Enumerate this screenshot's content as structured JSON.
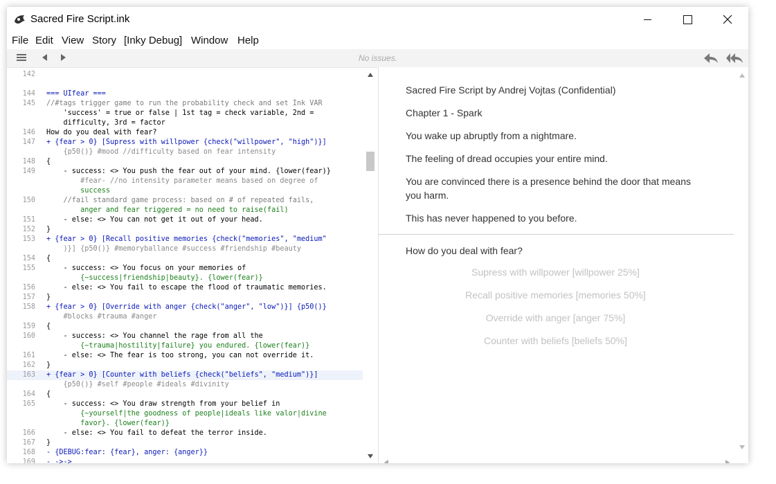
{
  "window": {
    "title": "Sacred Fire Script.ink"
  },
  "menu": [
    "File",
    "Edit",
    "View",
    "Story",
    "[Inky Debug]",
    "Window",
    "Help"
  ],
  "toolbar": {
    "status": "No issues."
  },
  "editor": {
    "lines": [
      {
        "n": "142",
        "t": ""
      },
      {
        "n": "",
        "t": ""
      },
      {
        "n": "144",
        "t": "=== UIfear ==="
      },
      {
        "n": "145",
        "t": "//#tags trigger game to run the probability check and set Ink VAR"
      },
      {
        "n": "",
        "t": "    'success' = true or false | 1st tag = check variable, 2nd ="
      },
      {
        "n": "",
        "t": "    difficulty, 3rd = factor"
      },
      {
        "n": "146",
        "t": "How do you deal with fear?"
      },
      {
        "n": "147",
        "t": "+ {fear > 0} [Supress with willpower {check(\"willpower\", \"high\")}]"
      },
      {
        "n": "",
        "t": "    {p50()} #mood //difficulty based on fear intensity"
      },
      {
        "n": "148",
        "t": "{"
      },
      {
        "n": "149",
        "t": "    - success: <> You push the fear out of your mind. {lower(fear)}"
      },
      {
        "n": "",
        "t": "        #fear- //no intensity parameter means based on degree of"
      },
      {
        "n": "",
        "t": "        success"
      },
      {
        "n": "150",
        "t": "    //fail standard game process: based on # of repeated fails,"
      },
      {
        "n": "",
        "t": "        anger and fear triggered = no need to raise(fail)"
      },
      {
        "n": "151",
        "t": "    - else: <> You can not get it out of your head."
      },
      {
        "n": "152",
        "t": "}"
      },
      {
        "n": "153",
        "t": "+ {fear > 0} [Recall positive memories {check(\"memories\", \"medium\""
      },
      {
        "n": "",
        "t": "    )}] {p50()} #memoryballance #success #friendship #beauty"
      },
      {
        "n": "154",
        "t": "{"
      },
      {
        "n": "155",
        "t": "    - success: <> You focus on your memories of"
      },
      {
        "n": "",
        "t": "        {~success|friendship|beauty}. {lower(fear)}"
      },
      {
        "n": "156",
        "t": "    - else: <> You fail to escape the flood of traumatic memories."
      },
      {
        "n": "157",
        "t": "}"
      },
      {
        "n": "158",
        "t": "+ {fear > 0} [Override with anger {check(\"anger\", \"low\")}] {p50()}"
      },
      {
        "n": "",
        "t": "    #blocks #trauma #anger"
      },
      {
        "n": "159",
        "t": "{"
      },
      {
        "n": "160",
        "t": "    - success: <> You channel the rage from all the"
      },
      {
        "n": "",
        "t": "        {~trauma|hostility|failure} you endured. {lower(fear)}"
      },
      {
        "n": "161",
        "t": "    - else: <> The fear is too strong, you can not override it."
      },
      {
        "n": "162",
        "t": "}"
      },
      {
        "n": "163",
        "t": "+ {fear > 0} [Counter with beliefs {check(\"beliefs\", \"medium\")}]"
      },
      {
        "n": "",
        "t": "    {p50()} #self #people #ideals #divinity"
      },
      {
        "n": "164",
        "t": "{"
      },
      {
        "n": "165",
        "t": "    - success: <> You draw strength from your belief in"
      },
      {
        "n": "",
        "t": "        {~yourself|the goodness of people|ideals like valor|divine"
      },
      {
        "n": "",
        "t": "        favor}. {lower(fear)}"
      },
      {
        "n": "166",
        "t": "    - else: <> You fail to defeat the terror inside."
      },
      {
        "n": "167",
        "t": "}"
      },
      {
        "n": "168",
        "t": "- {DEBUG:fear: {fear}, anger: {anger}}"
      },
      {
        "n": "169",
        "t": "- ->->"
      }
    ]
  },
  "player": {
    "paragraphs": [
      "Sacred Fire Script by Andrej Vojtas (Confidential)",
      "Chapter 1 - Spark",
      "You wake up abruptly from a nightmare.",
      "The feeling of dread occupies your entire mind.",
      "You are convinced there is a presence behind the door that means you harm.",
      "This has never happened to you before."
    ],
    "question": "How do you deal with fear?",
    "choices": [
      "Supress with willpower [willpower 25%]",
      "Recall positive memories [memories 50%]",
      "Override with anger [anger 75%]",
      "Counter with beliefs [beliefs 50%]"
    ]
  }
}
